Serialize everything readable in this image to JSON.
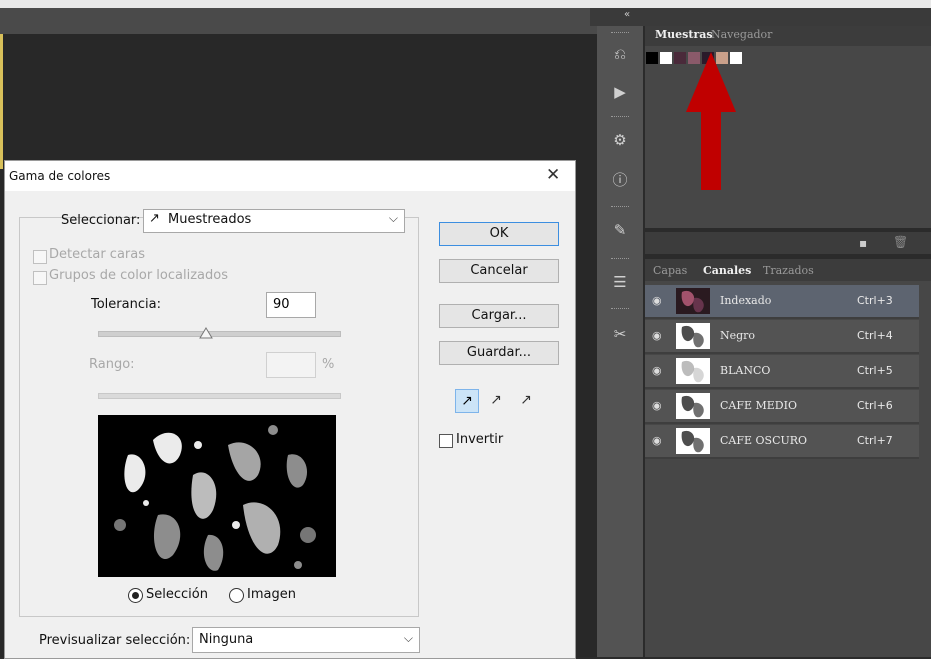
{
  "panel_collapse_glyph": "«",
  "swatches_panel": {
    "tabs": [
      "Muestras",
      "Navegador"
    ],
    "swatch_colors": [
      "#000000",
      "#ffffff",
      "#4a2a3a",
      "#8a5a6a",
      "#2a1a2a",
      "#caa08a",
      "#ffffff"
    ]
  },
  "channels_panel": {
    "tabs": [
      "Capas",
      "Canales",
      "Trazados"
    ],
    "channels": [
      {
        "name": "Indexado",
        "shortcut": "Ctrl+3",
        "selected": true
      },
      {
        "name": "Negro",
        "shortcut": "Ctrl+4",
        "selected": false
      },
      {
        "name": "BLANCO",
        "shortcut": "Ctrl+5",
        "selected": false
      },
      {
        "name": "CAFE MEDIO",
        "shortcut": "Ctrl+6",
        "selected": false
      },
      {
        "name": "CAFE OSCURO",
        "shortcut": "Ctrl+7",
        "selected": false
      }
    ]
  },
  "dialog": {
    "title": "Gama de colores",
    "close_glyph": "✕",
    "select_label": "Seleccionar:",
    "select_value": "Muestreados",
    "detect_faces": "Detectar caras",
    "localized_groups": "Grupos de color localizados",
    "tolerance_label": "Tolerancia:",
    "tolerance_value": "90",
    "range_label": "Rango:",
    "range_unit": "%",
    "radio_selection": "Selección",
    "radio_image": "Imagen",
    "preview_label": "Previsualizar selección:",
    "preview_value": "Ninguna",
    "buttons": {
      "ok": "OK",
      "cancel": "Cancelar",
      "load": "Cargar...",
      "save": "Guardar..."
    },
    "invert_label": "Invertir",
    "tolerance_slider_level": 0.45
  },
  "colors": {
    "annotation_arrow": "#c00000",
    "selected_row": "#5d6470",
    "default_button_border": "#3c8ee0"
  }
}
